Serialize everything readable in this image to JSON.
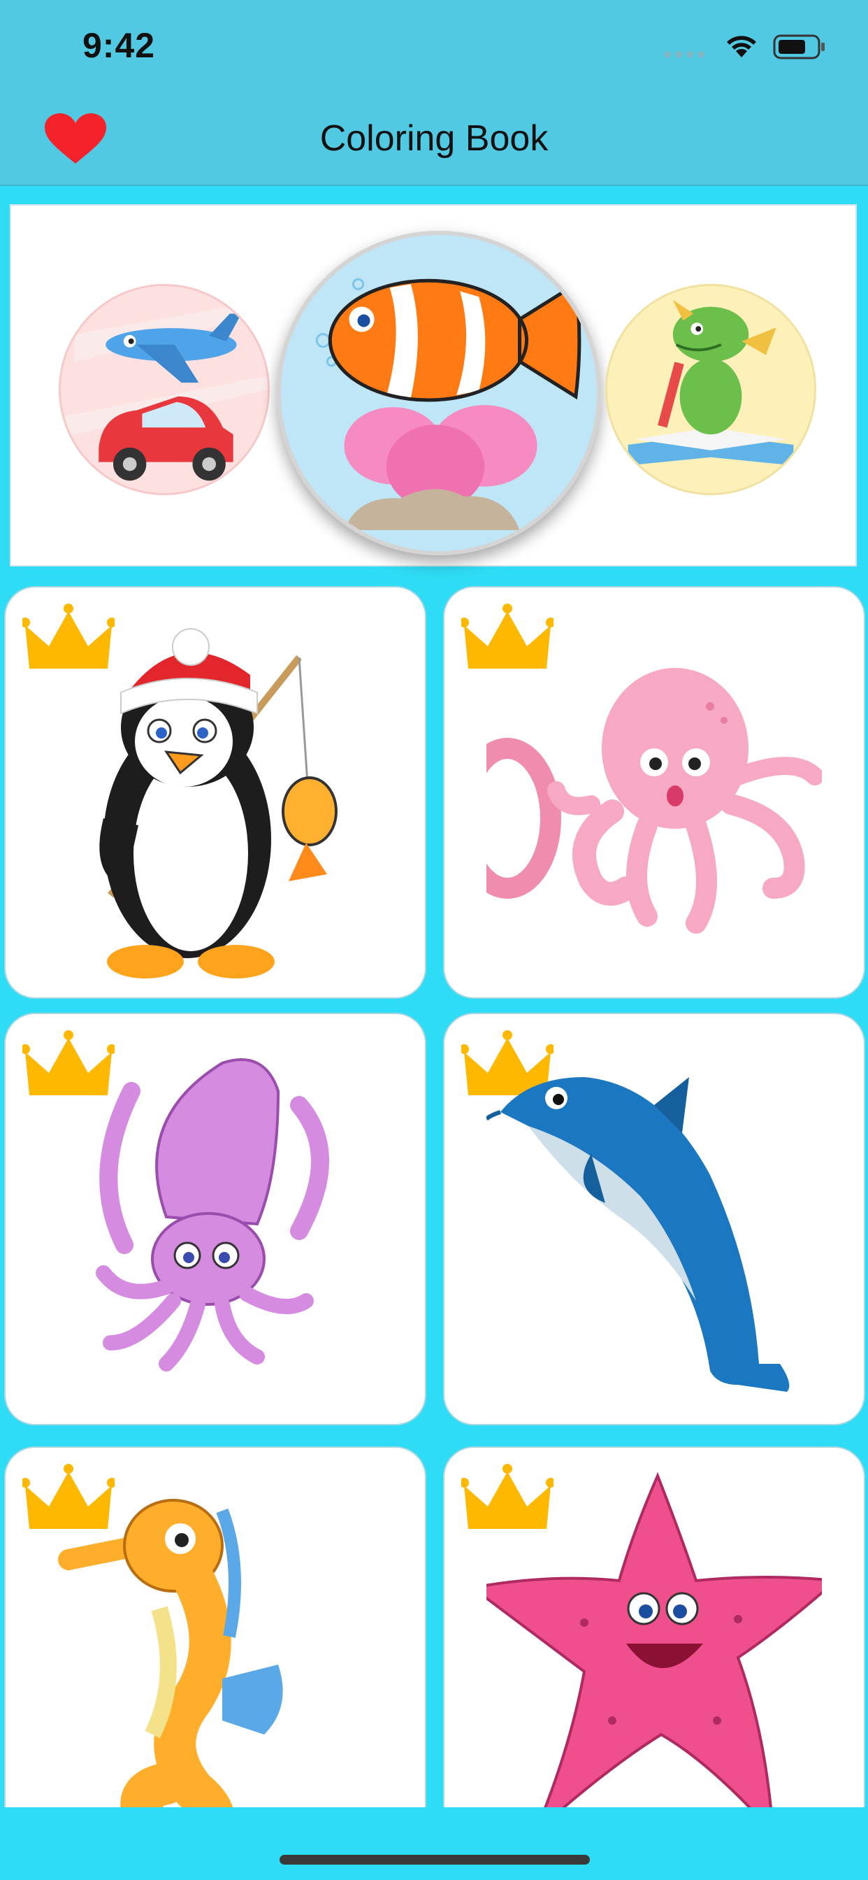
{
  "status_bar": {
    "time": "9:42",
    "icons": [
      "signal-dots-icon",
      "wifi-icon",
      "battery-icon"
    ]
  },
  "header": {
    "title": "Coloring Book",
    "favorite_icon": "heart-icon",
    "colors": {
      "background": "#52c9e2",
      "heart": "#f4222a"
    }
  },
  "carousel": {
    "items": [
      {
        "name": "vehicles",
        "icon": "airplane-car-icon"
      },
      {
        "name": "sea-animals",
        "icon": "clownfish-icon",
        "selected": true
      },
      {
        "name": "fantasy",
        "icon": "dragon-icon"
      }
    ]
  },
  "grid": {
    "items": [
      {
        "name": "penguin",
        "premium": true,
        "icon": "penguin-icon"
      },
      {
        "name": "octopus",
        "premium": true,
        "icon": "octopus-icon"
      },
      {
        "name": "squid",
        "premium": true,
        "icon": "squid-icon"
      },
      {
        "name": "dolphin",
        "premium": true,
        "icon": "dolphin-icon"
      },
      {
        "name": "seahorse",
        "premium": true,
        "icon": "seahorse-icon"
      },
      {
        "name": "starfish",
        "premium": true,
        "icon": "starfish-icon"
      }
    ],
    "badge_icon": "crown-icon",
    "colors": {
      "background": "#2fdcf5",
      "crown": "#ffb800"
    }
  }
}
